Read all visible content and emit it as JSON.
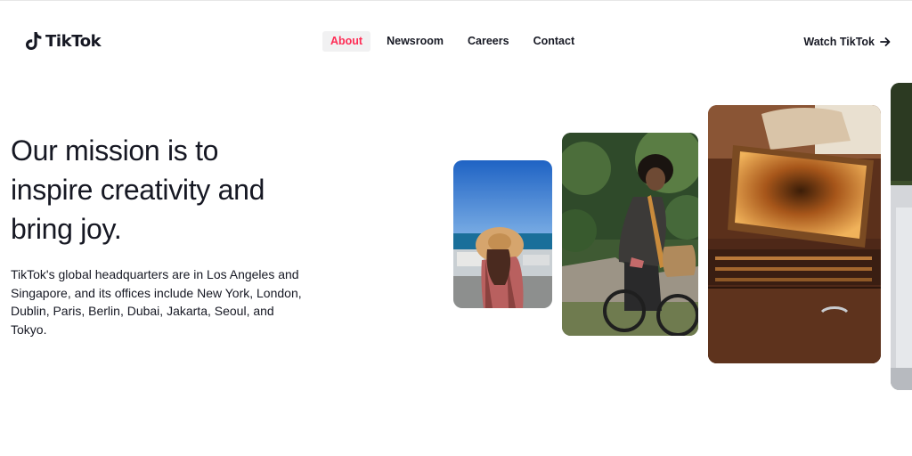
{
  "header": {
    "logo_text": "TikTok",
    "nav": [
      {
        "label": "About",
        "active": true
      },
      {
        "label": "Newsroom",
        "active": false
      },
      {
        "label": "Careers",
        "active": false
      },
      {
        "label": "Contact",
        "active": false
      }
    ],
    "cta_label": "Watch TikTok",
    "cta_icon": "arrow-right-icon"
  },
  "hero": {
    "headline": "Our mission is to inspire creativity and bring joy.",
    "description": "TikTok's global headquarters are in Los Angeles and Singapore, and its offices include New York, London, Dublin, Paris, Berlin, Dubai, Jakarta, Seoul, and Tokyo."
  },
  "colors": {
    "accent": "#fe2c55",
    "text": "#161823",
    "nav_active_bg": "#f1f1f2"
  }
}
